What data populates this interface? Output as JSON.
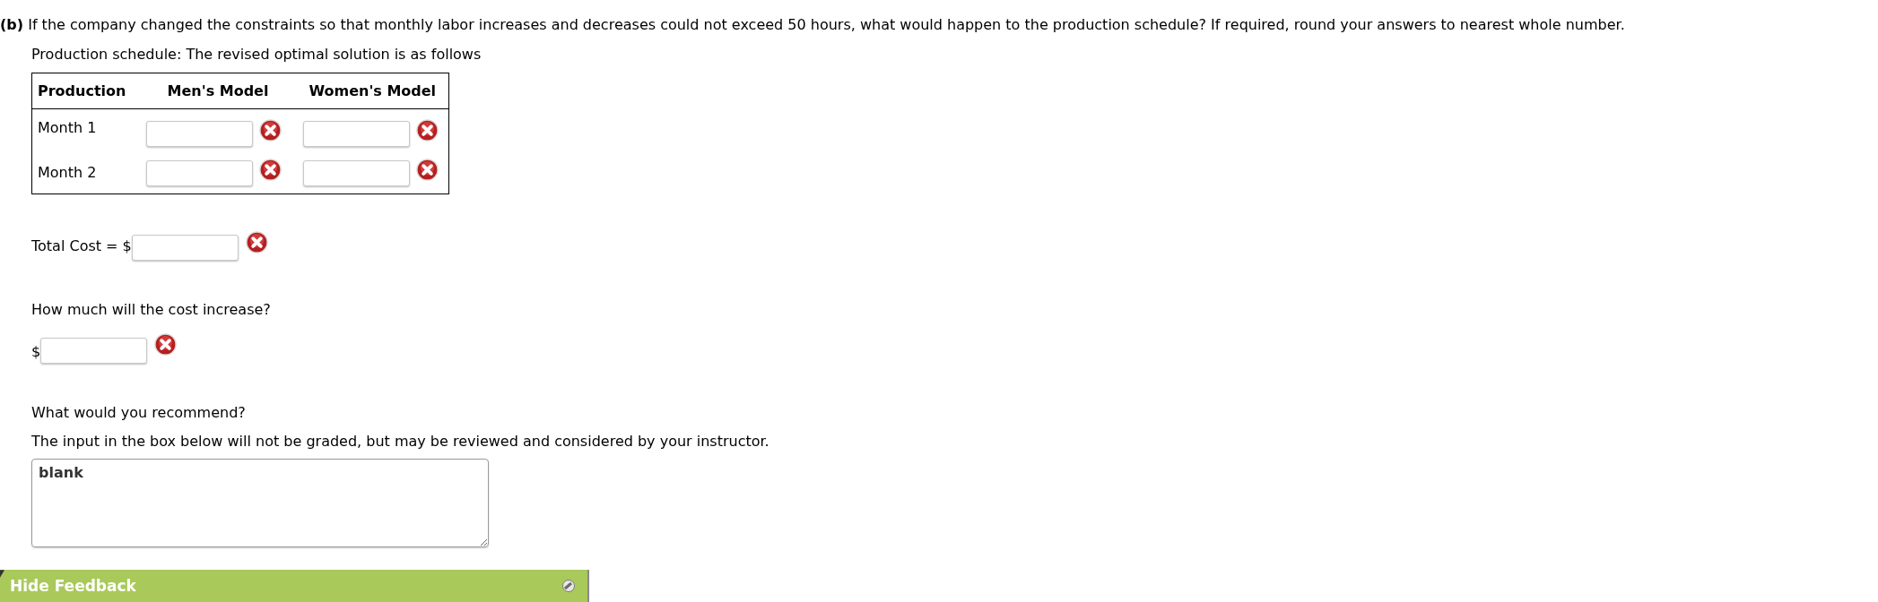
{
  "question": {
    "text": "**(b)** If the company changed the constraints so that monthly labor increases and decreases could not exceed 50 hours, what would happen to the production schedule? If required, round your answers to nearest whole number."
  },
  "production_schedule": {
    "intro": "Production schedule: The revised optimal solution is as follows",
    "table": {
      "columns": [
        "Production",
        "Men's Model",
        "Women's Model"
      ],
      "rows": [
        {
          "label": "Month 1",
          "answers": [
            {
              "correct": false
            },
            {
              "correct": false
            }
          ]
        },
        {
          "label": "Month 2",
          "answers": [
            {
              "correct": false
            },
            {
              "correct": false
            }
          ]
        }
      ]
    }
  },
  "total_cost": {
    "label": "Total Cost = $",
    "correct": false
  },
  "cost_increase": {
    "question": "How much will the cost increase?",
    "prefix": "$",
    "correct": false
  },
  "recommendation": {
    "question": "What would you recommend?",
    "note": "The input in the box below will not be graded, but may be reviewed and considered by your instructor.",
    "value": "blank"
  },
  "feedback_bar": {
    "label": "Hide Feedback"
  }
}
